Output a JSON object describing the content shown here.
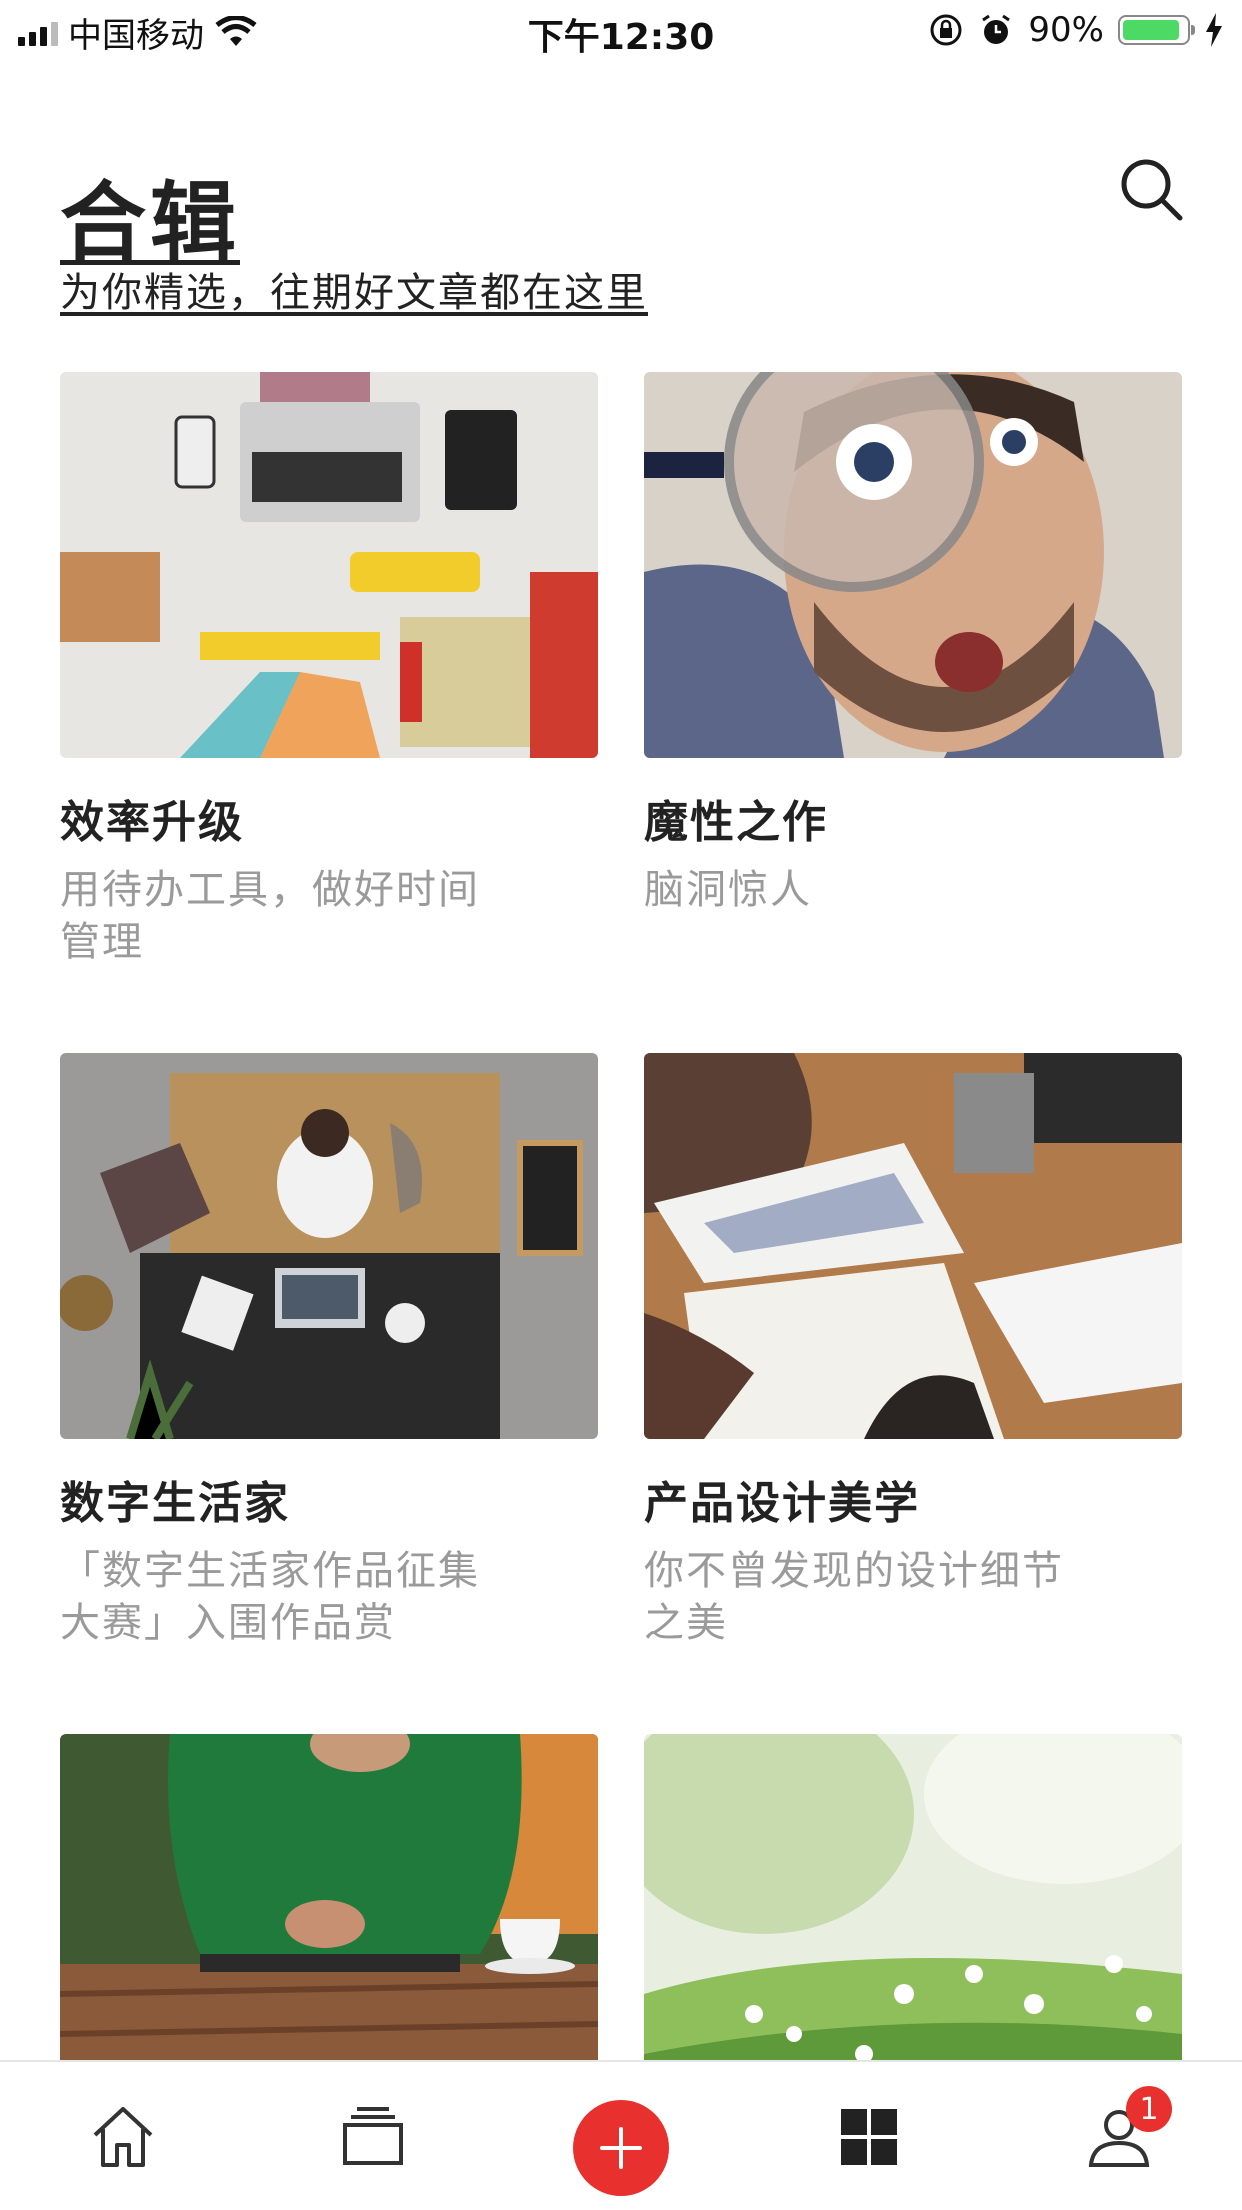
{
  "status_bar": {
    "carrier": "中国移动",
    "time": "下午12:30",
    "battery_percent_label": "90%",
    "battery_level": 0.9
  },
  "header": {
    "title": "合辑",
    "subtitle": "为你精选，往期好文章都在这里",
    "search_icon": "search-icon"
  },
  "collections": [
    {
      "title": "效率升级",
      "description": "用待办工具，做好时间管理"
    },
    {
      "title": "魔性之作",
      "description": "脑洞惊人"
    },
    {
      "title": "数字生活家",
      "description": "「数字生活家作品征集大赛」入围作品赏"
    },
    {
      "title": "产品设计美学",
      "description": "你不曾发现的设计细节之美"
    },
    {
      "title": "",
      "description": ""
    },
    {
      "title": "",
      "description": ""
    }
  ],
  "tab_bar": {
    "items": [
      "home-icon",
      "collections-icon",
      "plus-icon",
      "grid-icon",
      "profile-icon"
    ],
    "profile_badge": "1",
    "accent_color": "#e8302f"
  }
}
